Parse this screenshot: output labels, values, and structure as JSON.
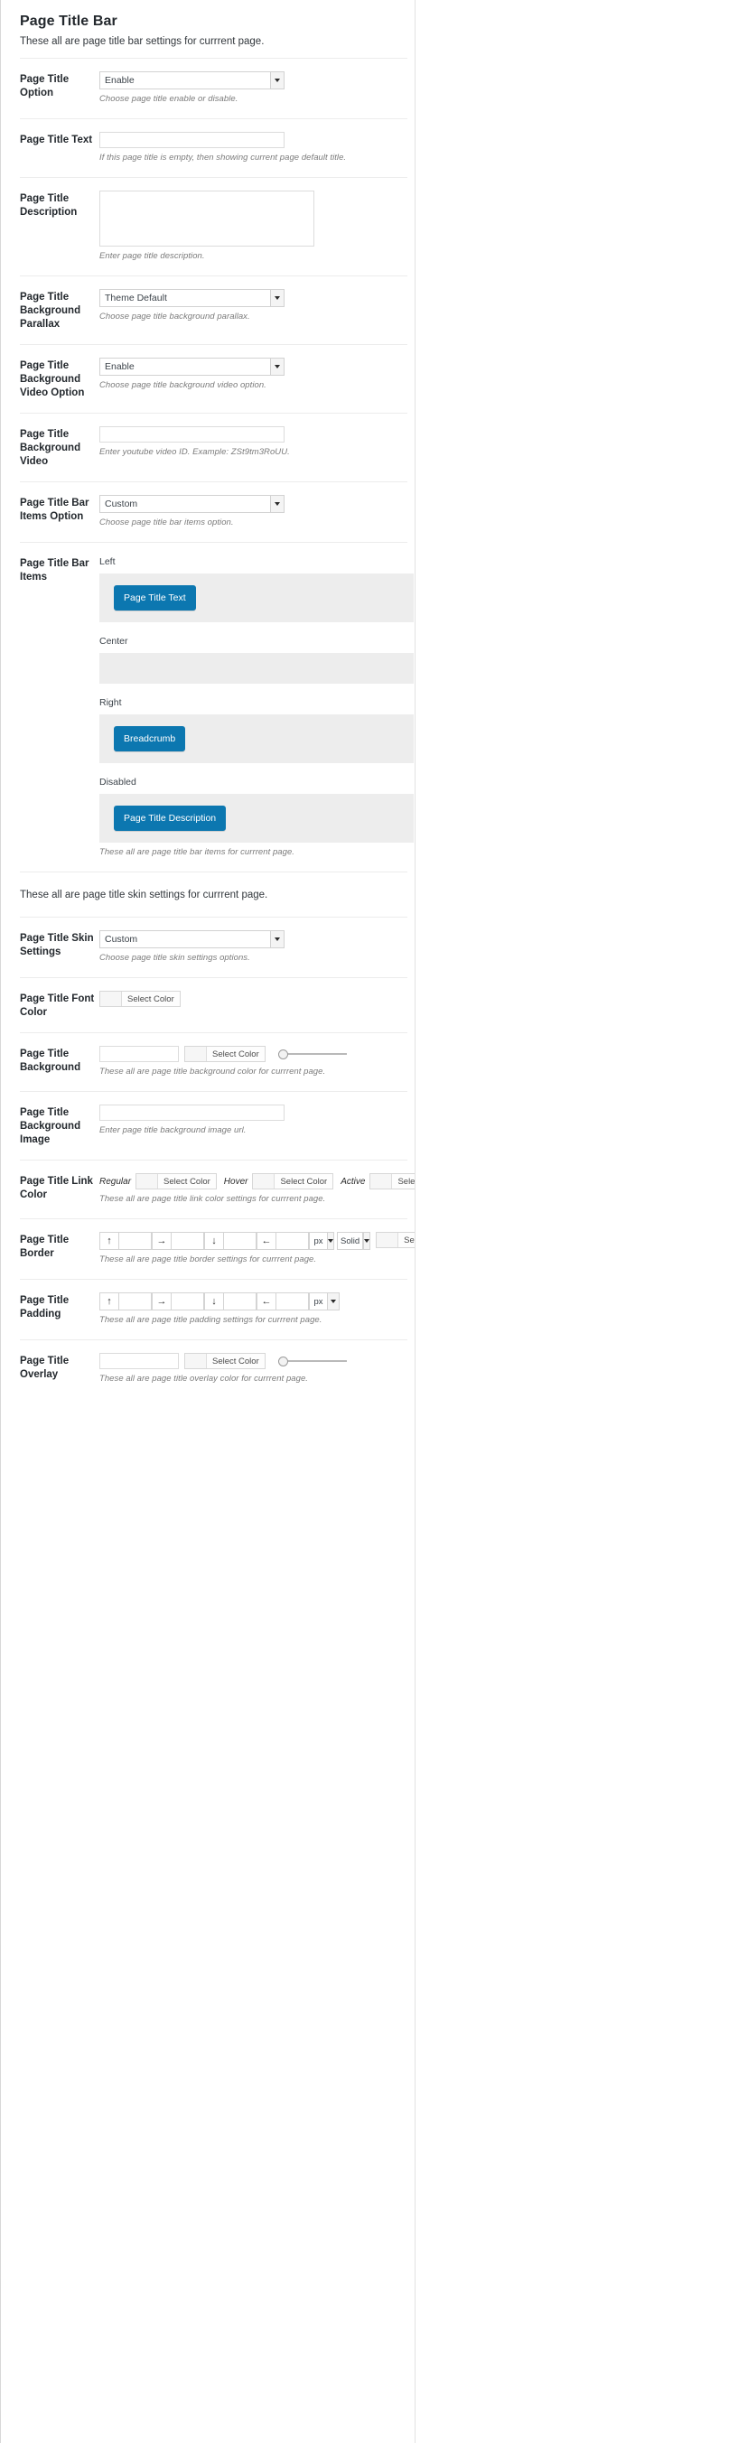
{
  "section_bar": {
    "title": "Page Title Bar",
    "subtitle": "These all are page title bar settings for currrent page."
  },
  "rows": {
    "page_title_option": {
      "label": "Page Title Option",
      "value": "Enable",
      "desc": "Choose page title enable or disable."
    },
    "page_title_text": {
      "label": "Page Title Text",
      "value": "",
      "desc": "If this page title is empty, then showing current page default title."
    },
    "page_title_description": {
      "label": "Page Title Description",
      "value": "",
      "desc": "Enter page title description."
    },
    "page_title_bg_parallax": {
      "label": "Page Title Background Parallax",
      "value": "Theme Default",
      "desc": "Choose page title background parallax."
    },
    "page_title_bg_video_option": {
      "label": "Page Title Background Video Option",
      "value": "Enable",
      "desc": "Choose page title background video option."
    },
    "page_title_bg_video": {
      "label": "Page Title Background Video",
      "value": "",
      "desc": "Enter youtube video ID. Example: ZSt9tm3RoUU."
    },
    "page_title_bar_items_option": {
      "label": "Page Title Bar Items Option",
      "value": "Custom",
      "desc": "Choose page title bar items option."
    },
    "page_title_bar_items": {
      "label": "Page Title Bar Items",
      "desc": "These all are page title bar items for currrent page.",
      "zones": [
        {
          "name": "Left",
          "chips": [
            "Page Title Text"
          ]
        },
        {
          "name": "Center",
          "chips": []
        },
        {
          "name": "Right",
          "chips": [
            "Breadcrumb"
          ]
        },
        {
          "name": "Disabled",
          "chips": [
            "Page Title Description"
          ]
        }
      ]
    },
    "skin_band": "These all are page title skin settings for currrent page.",
    "page_title_skin_settings": {
      "label": "Page Title Skin Settings",
      "value": "Custom",
      "desc": "Choose page title skin settings options."
    },
    "page_title_font_color": {
      "label": "Page Title Font Color",
      "button": "Select Color",
      "swatch": "#f6f6f6"
    },
    "page_title_background": {
      "label": "Page Title Background",
      "value": "",
      "button": "Select Color",
      "desc": "These all are page title background color for currrent page.",
      "opacity_position": "0"
    },
    "page_title_background_image": {
      "label": "Page Title Background Image",
      "value": "",
      "desc": "Enter page title background image url."
    },
    "page_title_link_color": {
      "label": "Page Title Link Color",
      "desc": "These all are page title link color settings for currrent page.",
      "states": [
        {
          "name": "Regular",
          "button": "Select Color"
        },
        {
          "name": "Hover",
          "button": "Select Color"
        },
        {
          "name": "Active",
          "button": "Select Color"
        }
      ]
    },
    "page_title_border": {
      "label": "Page Title Border",
      "desc": "These all are page title border settings for currrent page.",
      "sides": [
        {
          "icon": "arrow-up-icon",
          "glyph": "↑",
          "value": ""
        },
        {
          "icon": "arrow-right-icon",
          "glyph": "→",
          "value": ""
        },
        {
          "icon": "arrow-down-icon",
          "glyph": "↓",
          "value": ""
        },
        {
          "icon": "arrow-left-icon",
          "glyph": "←",
          "value": ""
        }
      ],
      "unit": "px",
      "style": "Solid",
      "button": "Select Color"
    },
    "page_title_padding": {
      "label": "Page Title Padding",
      "desc": "These all are page title padding settings for currrent page.",
      "sides": [
        {
          "icon": "arrow-up-icon",
          "glyph": "↑",
          "value": ""
        },
        {
          "icon": "arrow-right-icon",
          "glyph": "→",
          "value": ""
        },
        {
          "icon": "arrow-down-icon",
          "glyph": "↓",
          "value": ""
        },
        {
          "icon": "arrow-left-icon",
          "glyph": "←",
          "value": ""
        }
      ],
      "unit": "px"
    },
    "page_title_overlay": {
      "label": "Page Title Overlay",
      "value": "",
      "button": "Select Color",
      "desc": "These all are page title overlay color for currrent page.",
      "opacity_position": "0"
    }
  },
  "colors": {
    "chip_blue": "#0c77b0",
    "dropzone_gray": "#ededed"
  }
}
